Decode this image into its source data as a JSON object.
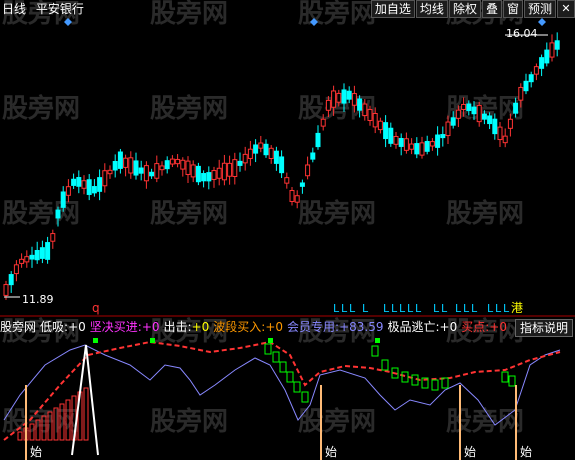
{
  "header": {
    "period": "日线",
    "stock_name": "平安银行"
  },
  "toolbar": {
    "add_watch": "加自选",
    "ma_lines": "均线",
    "ex_rights": "除权",
    "overlay": "叠",
    "window": "窗",
    "forecast": "预测",
    "close": "✕"
  },
  "watermark": "股旁网",
  "price_labels": {
    "high": "16.04",
    "low": "11.89"
  },
  "indicator": {
    "panel_name": "股旁网",
    "items": [
      {
        "label": "低吸:",
        "value": "+0",
        "color": "#ffffff"
      },
      {
        "label": "坚决买进:",
        "value": "+0",
        "color": "#ff33ff"
      },
      {
        "label": "出击:",
        "value": "+0",
        "color": "#ffff00"
      },
      {
        "label": "波段买入:",
        "value": "+0",
        "color": "#ff9900"
      },
      {
        "label": "会员专用:",
        "value": "+83.59",
        "color": "#8888ff"
      },
      {
        "label": "极品逃亡:",
        "value": "+0",
        "color": "#ffffff"
      },
      {
        "label": "买点:",
        "value": "+0",
        "color": "#ff3333"
      }
    ],
    "help_button": "指标说明"
  },
  "markers": {
    "q_label": "q",
    "gang_label": "港",
    "start_label": "始",
    "L_label": "L"
  },
  "colors": {
    "up": "#ff3333",
    "down": "#00ffff",
    "line": "#8888ff",
    "green": "#00ff00",
    "diamond": "#4499ff"
  }
}
